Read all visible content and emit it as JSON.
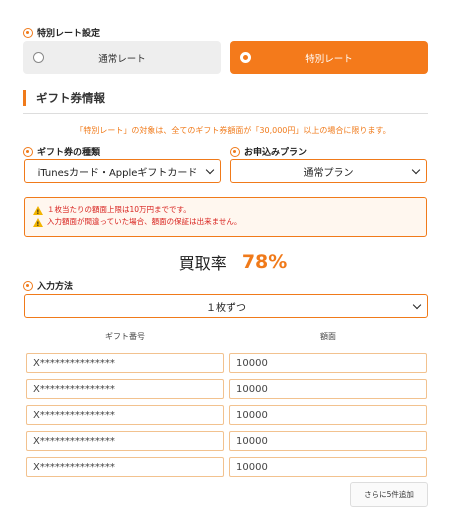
{
  "special_rate": {
    "label": "特別レート設定",
    "options": [
      {
        "label": "通常レート",
        "selected": false
      },
      {
        "label": "特別レート",
        "selected": true
      }
    ]
  },
  "gift_info": {
    "heading": "ギフト券情報",
    "notice": "「特別レート」の対象は、全てのギフト券額面が「30,000円」以上の場合に限ります。",
    "type_label": "ギフト券の種類",
    "type_value": "iTunesカード・Appleギフトカード",
    "plan_label": "お申込みプラン",
    "plan_value": "通常プラン"
  },
  "warnings": [
    "１枚当たりの額面上限は10万円までです。",
    "入力額面が間違っていた場合、額面の保証は出来ません。"
  ],
  "purchase_rate": {
    "label": "買取率",
    "value": "78%"
  },
  "input_method": {
    "label": "入力方法",
    "value": "１枚ずつ"
  },
  "table": {
    "headers": [
      "ギフト番号",
      "額面"
    ],
    "rows": [
      {
        "number": "X***************",
        "amount": "10000"
      },
      {
        "number": "X***************",
        "amount": "10000"
      },
      {
        "number": "X***************",
        "amount": "10000"
      },
      {
        "number": "X***************",
        "amount": "10000"
      },
      {
        "number": "X***************",
        "amount": "10000"
      }
    ]
  },
  "add_button": "さらに5件追加",
  "colors": {
    "accent": "#f47a1b",
    "warning_text": "#d8221e",
    "border_light": "#f2c28f"
  }
}
